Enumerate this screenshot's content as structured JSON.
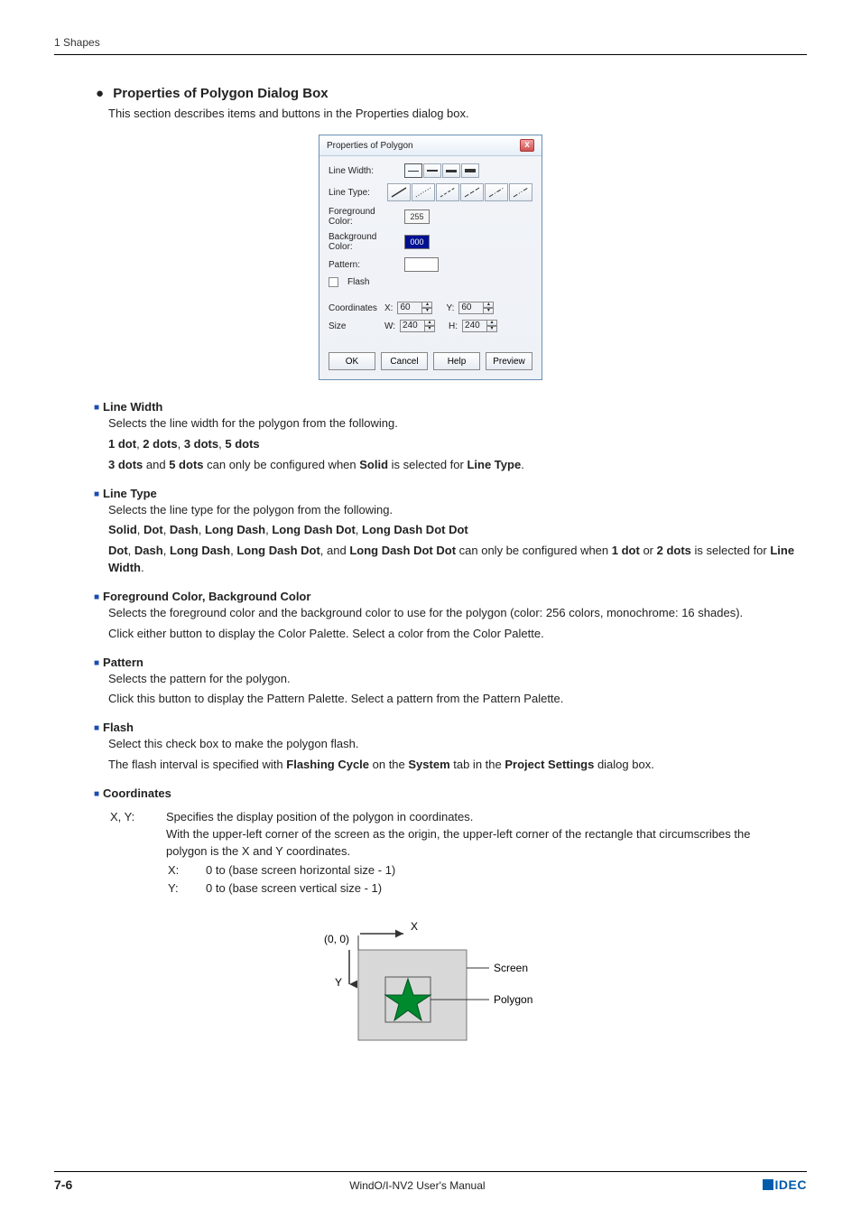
{
  "header": {
    "chapter": "1 Shapes"
  },
  "heading": {
    "title": "Properties of Polygon Dialog Box"
  },
  "intro": "This section describes items and buttons in the Properties dialog box.",
  "dialog": {
    "title": "Properties of Polygon",
    "labels": {
      "lineWidth": "Line Width:",
      "lineType": "Line Type:",
      "fg": "Foreground Color:",
      "bg": "Background Color:",
      "pattern": "Pattern:",
      "flash": "Flash",
      "coordinates": "Coordinates",
      "x": "X:",
      "y": "Y:",
      "size": "Size",
      "w": "W:",
      "h": "H:"
    },
    "values": {
      "fgSwatch": "255",
      "bgSwatch": "000",
      "x": "60",
      "y": "60",
      "w": "240",
      "h": "240"
    },
    "buttons": {
      "ok": "OK",
      "cancel": "Cancel",
      "help": "Help",
      "preview": "Preview"
    }
  },
  "sections": {
    "lineWidth": {
      "title": "Line Width",
      "p1": "Selects the line width for the polygon from the following.",
      "b1": "1 dot",
      "b2": "2 dots",
      "b3": "3 dots",
      "b4": "5 dots",
      "p2a": "3 dots",
      "p2b": "5 dots",
      "p2c": "Solid",
      "p2d": "Line Type",
      "p2_t1": " and ",
      "p2_t2": " can only be configured when ",
      "p2_t3": " is selected for ",
      "p2_t4": "."
    },
    "lineType": {
      "title": "Line Type",
      "p1": "Selects the line type for the polygon from the following.",
      "b1": "Solid",
      "b2": "Dot",
      "b3": "Dash",
      "b4": "Long Dash",
      "b5": "Long Dash Dot",
      "b6": "Long Dash Dot Dot",
      "p2_b1": "Dot",
      "p2_b2": "Dash",
      "p2_b3": "Long Dash",
      "p2_b4": "Long Dash Dot",
      "p2_b5": "Long Dash Dot Dot",
      "p2_b6": "1 dot",
      "p2_b7": "2 dots",
      "p2_b8": "Line Width",
      "p2_t1": ", ",
      "p2_t2": ", and ",
      "p2_t3": " can only be configured when ",
      "p2_t4": " or ",
      "p2_t5": " is selected for ",
      "p2_t6": "."
    },
    "fgbg": {
      "title": "Foreground Color, Background Color",
      "p1": "Selects the foreground color and the background color to use for the polygon (color: 256 colors, monochrome: 16 shades).",
      "p2": "Click either button to display the Color Palette. Select a color from the Color Palette."
    },
    "pattern": {
      "title": "Pattern",
      "p1": "Selects the pattern for the polygon.",
      "p2": "Click this button to display the Pattern Palette. Select a pattern from the Pattern Palette."
    },
    "flash": {
      "title": "Flash",
      "p1": "Select this check box to make the polygon flash.",
      "p2_t1": "The flash interval is specified with ",
      "p2_b1": "Flashing Cycle",
      "p2_t2": " on the ",
      "p2_b2": "System",
      "p2_t3": " tab in the ",
      "p2_b3": "Project Settings",
      "p2_t4": " dialog box."
    },
    "coords": {
      "title": "Coordinates",
      "label": "X, Y:",
      "p1": "Specifies the display position of the polygon in coordinates.",
      "p2": "With the upper-left corner of the screen as the origin, the upper-left corner of the rectangle that circumscribes the polygon is the X and Y coordinates.",
      "xrow": {
        "lab": "X:",
        "val": "0 to (base screen horizontal size - 1)"
      },
      "yrow": {
        "lab": "Y:",
        "val": "0 to (base screen vertical size - 1)"
      }
    }
  },
  "diagram": {
    "origin": "(0, 0)",
    "x": "X",
    "y": "Y",
    "screen": "Screen",
    "polygon": "Polygon"
  },
  "footer": {
    "page": "7-6",
    "manual": "WindO/I-NV2 User's Manual",
    "brand": "IDEC"
  }
}
